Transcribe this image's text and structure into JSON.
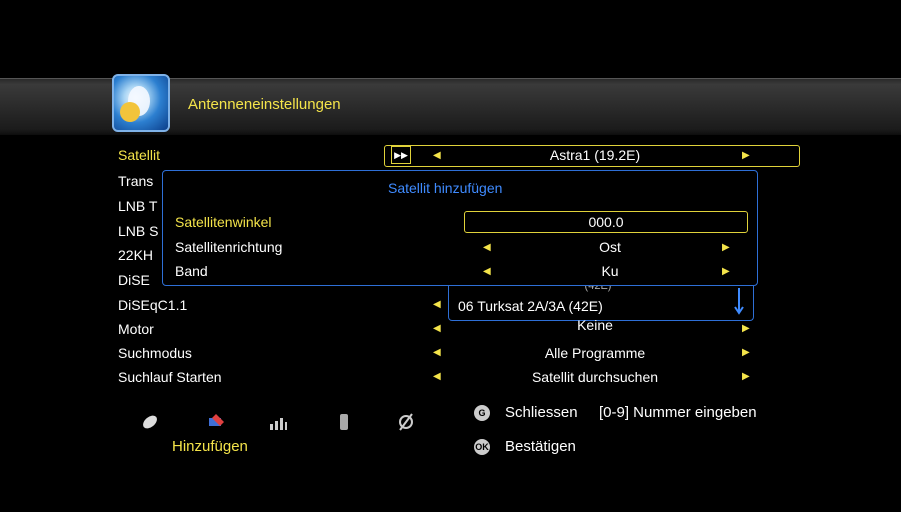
{
  "page": {
    "title": "Antenneneinstellungen"
  },
  "menu": {
    "items": [
      {
        "label": "Satellit"
      },
      {
        "label": "Trans"
      },
      {
        "label": "LNB T"
      },
      {
        "label": "LNB S"
      },
      {
        "label": "22KH"
      },
      {
        "label": "DiSE"
      },
      {
        "label": "DiSEqC1.1"
      },
      {
        "label": "Motor"
      },
      {
        "label": "Suchmodus"
      },
      {
        "label": "Suchlauf Starten"
      }
    ],
    "satellite_value": "Astra1 (19.2E)",
    "motor_value": "Keine",
    "suchmodus_value": "Alle Programme",
    "suchlauf_value": "Satellit durchsuchen",
    "diseqc_partial": "(42E)"
  },
  "satellite_list": {
    "selected": "06  Turksat 2A/3A (42E)"
  },
  "dialog": {
    "title": "Satellit hinzufügen",
    "rows": [
      {
        "label": "Satellitenwinkel",
        "value": "000.0"
      },
      {
        "label": "Satellitenrichtung",
        "value": "Ost"
      },
      {
        "label": "Band",
        "value": "Ku"
      }
    ]
  },
  "footer": {
    "icons": [
      "satellite-dish-icon",
      "edit-icon",
      "signal-icon",
      "delete-icon",
      "disable-icon"
    ],
    "action_label": "Hinzufügen",
    "help_close": "Schliessen",
    "help_number": "[0-9]  Nummer eingeben",
    "help_confirm": "Bestätigen",
    "key_close": "G",
    "key_ok": "OK"
  },
  "colors": {
    "accent": "#f4e44a",
    "dialog_border": "#2e6fd6",
    "dialog_title": "#3f8bff"
  }
}
